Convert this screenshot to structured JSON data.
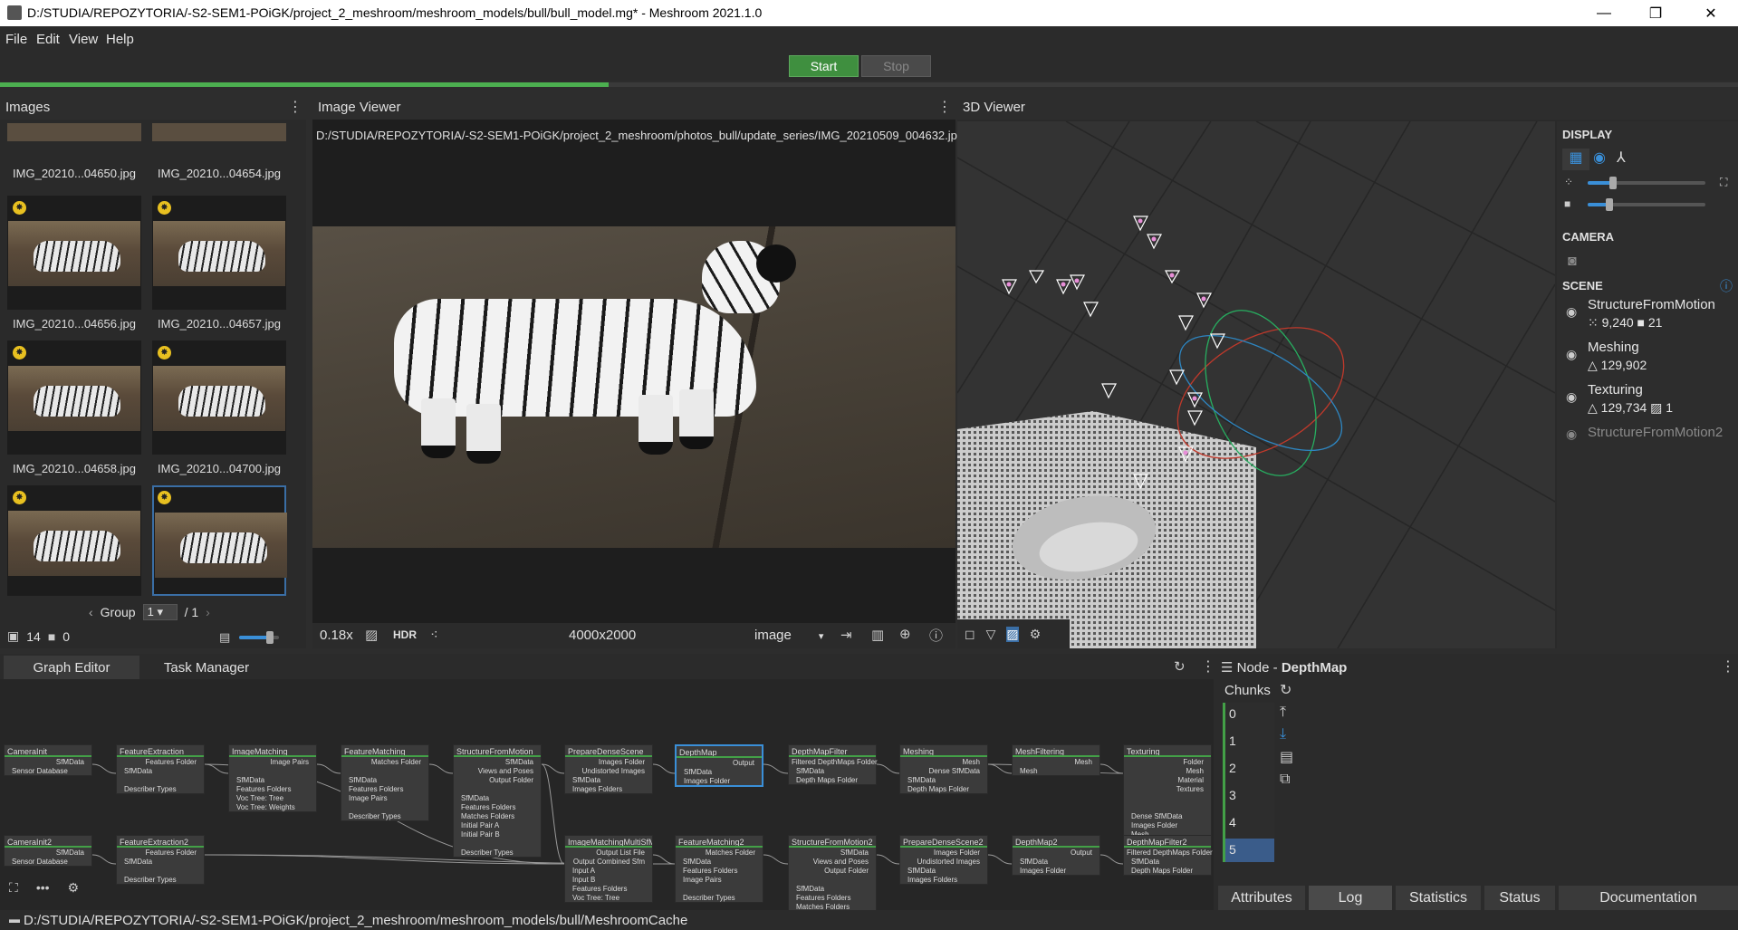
{
  "window": {
    "title": "D:/STUDIA/REPOZYTORIA/-S2-SEM1-POiGK/project_2_meshroom/meshroom_models/bull/bull_model.mg* - Meshroom 2021.1.0",
    "minimize": "—",
    "maximize": "❐",
    "close": "✕"
  },
  "menu": [
    "File",
    "Edit",
    "View",
    "Help"
  ],
  "toolbar": {
    "start": "Start",
    "stop": "Stop",
    "progress_fraction": 0.35
  },
  "images_panel": {
    "title": "Images",
    "top_labels": [
      "IMG_20210...04650.jpg",
      "IMG_20210...04654.jpg"
    ],
    "thumbs": [
      {
        "label": "IMG_20210...04656.jpg"
      },
      {
        "label": "IMG_20210...04657.jpg"
      },
      {
        "label": "IMG_20210...04658.jpg"
      },
      {
        "label": "IMG_20210...04700.jpg"
      },
      {
        "label": ""
      },
      {
        "label": ""
      }
    ],
    "group_label": "Group",
    "group_value": "1",
    "group_total": "/ 1",
    "image_count": "14",
    "camera_count": "0"
  },
  "image_viewer": {
    "title": "Image Viewer",
    "path": "D:/STUDIA/REPOZYTORIA/-S2-SEM1-POiGK/project_2_meshroom/photos_bull/update_series/IMG_20210509_004632.jpg",
    "zoom": "0.18x",
    "hdr": "HDR",
    "resolution": "4000x2000",
    "mode": "image"
  },
  "viewer3d": {
    "title": "3D Viewer",
    "display_label": "DISPLAY",
    "camera_label": "CAMERA",
    "scene_label": "SCENE",
    "scene_items": [
      {
        "name": "StructureFromMotion",
        "stats": "⁙ 9,240  ■ 21",
        "dim": false
      },
      {
        "name": "Meshing",
        "stats": "△ 129,902",
        "dim": false
      },
      {
        "name": "Texturing",
        "stats": "△ 129,734  ▨ 1",
        "dim": false
      },
      {
        "name": "StructureFromMotion2",
        "stats": "",
        "dim": true
      }
    ]
  },
  "bottom": {
    "tabs": [
      "Graph Editor",
      "Task Manager"
    ],
    "node_label": "Node - ",
    "node_name": "DepthMap",
    "chunks_label": "Chunks",
    "chunks": [
      "0",
      "1",
      "2",
      "3",
      "4",
      "5"
    ],
    "bottom_tabs": [
      "Attributes",
      "Log",
      "Statistics",
      "Status",
      "Documentation"
    ]
  },
  "graph_nodes": [
    {
      "title": "CameraInit",
      "ports": [
        {
          "t": "SfMData",
          "o": true
        },
        {
          "t": "Sensor Database",
          "o": false
        }
      ]
    },
    {
      "title": "FeatureExtraction",
      "ports": [
        {
          "t": "Features Folder",
          "o": true
        },
        {
          "t": "SfMData",
          "o": false
        },
        {
          "t": "",
          "o": false
        },
        {
          "t": "Describer Types",
          "o": false
        }
      ]
    },
    {
      "title": "ImageMatching",
      "ports": [
        {
          "t": "Image Pairs",
          "o": true
        },
        {
          "t": "",
          "o": false
        },
        {
          "t": "SfMData",
          "o": false
        },
        {
          "t": "Features Folders",
          "o": false
        },
        {
          "t": "Voc Tree: Tree",
          "o": false
        },
        {
          "t": "Voc Tree: Weights",
          "o": false
        }
      ]
    },
    {
      "title": "FeatureMatching",
      "ports": [
        {
          "t": "Matches Folder",
          "o": true
        },
        {
          "t": "",
          "o": false
        },
        {
          "t": "SfMData",
          "o": false
        },
        {
          "t": "Features Folders",
          "o": false
        },
        {
          "t": "Image Pairs",
          "o": false
        },
        {
          "t": "",
          "o": false
        },
        {
          "t": "Describer Types",
          "o": false
        }
      ]
    },
    {
      "title": "StructureFromMotion",
      "ports": [
        {
          "t": "SfMData",
          "o": true
        },
        {
          "t": "Views and Poses",
          "o": true
        },
        {
          "t": "Output Folder",
          "o": true
        },
        {
          "t": "",
          "o": false
        },
        {
          "t": "SfMData",
          "o": false
        },
        {
          "t": "Features Folders",
          "o": false
        },
        {
          "t": "Matches Folders",
          "o": false
        },
        {
          "t": "Initial Pair A",
          "o": false
        },
        {
          "t": "Initial Pair B",
          "o": false
        },
        {
          "t": "",
          "o": false
        },
        {
          "t": "Describer Types",
          "o": false
        }
      ]
    },
    {
      "title": "PrepareDenseScene",
      "ports": [
        {
          "t": "Images Folder",
          "o": true
        },
        {
          "t": "Undistorted Images",
          "o": true
        },
        {
          "t": "SfMData",
          "o": false
        },
        {
          "t": "Images Folders",
          "o": false
        }
      ]
    },
    {
      "title": "DepthMap",
      "ports": [
        {
          "t": "Output",
          "o": true
        },
        {
          "t": "SfMData",
          "o": false
        },
        {
          "t": "Images Folder",
          "o": false
        }
      ]
    },
    {
      "title": "DepthMapFilter",
      "ports": [
        {
          "t": "Filtered DepthMaps Folder",
          "o": true
        },
        {
          "t": "SfMData",
          "o": false
        },
        {
          "t": "Depth Maps Folder",
          "o": false
        }
      ]
    },
    {
      "title": "Meshing",
      "ports": [
        {
          "t": "Mesh",
          "o": true
        },
        {
          "t": "Dense SfMData",
          "o": true
        },
        {
          "t": "SfMData",
          "o": false
        },
        {
          "t": "Depth Maps Folder",
          "o": false
        }
      ]
    },
    {
      "title": "MeshFiltering",
      "ports": [
        {
          "t": "Mesh",
          "o": true
        },
        {
          "t": "Mesh",
          "o": false
        }
      ]
    },
    {
      "title": "Texturing",
      "ports": [
        {
          "t": "Folder",
          "o": true
        },
        {
          "t": "Mesh",
          "o": true
        },
        {
          "t": "Material",
          "o": true
        },
        {
          "t": "Textures",
          "o": true
        },
        {
          "t": "",
          "o": false
        },
        {
          "t": "",
          "o": false
        },
        {
          "t": "Dense SfMData",
          "o": false
        },
        {
          "t": "Images Folder",
          "o": false
        },
        {
          "t": "Mesh",
          "o": false
        }
      ]
    },
    {
      "title": "CameraInit2",
      "ports": [
        {
          "t": "SfMData",
          "o": true
        },
        {
          "t": "Sensor Database",
          "o": false
        }
      ]
    },
    {
      "title": "FeatureExtraction2",
      "ports": [
        {
          "t": "Features Folder",
          "o": true
        },
        {
          "t": "SfMData",
          "o": false
        },
        {
          "t": "",
          "o": false
        },
        {
          "t": "Describer Types",
          "o": false
        }
      ]
    },
    {
      "title": "ImageMatchingMultiSfM",
      "ports": [
        {
          "t": "Output List File",
          "o": true
        },
        {
          "t": "Output Combined Sfm",
          "o": true
        },
        {
          "t": "Input A",
          "o": false
        },
        {
          "t": "Input B",
          "o": false
        },
        {
          "t": "Features Folders",
          "o": false
        },
        {
          "t": "Voc Tree: Tree",
          "o": false
        }
      ]
    },
    {
      "title": "FeatureMatching2",
      "ports": [
        {
          "t": "Matches Folder",
          "o": true
        },
        {
          "t": "SfMData",
          "o": false
        },
        {
          "t": "Features Folders",
          "o": false
        },
        {
          "t": "Image Pairs",
          "o": false
        },
        {
          "t": "",
          "o": false
        },
        {
          "t": "Describer Types",
          "o": false
        }
      ]
    },
    {
      "title": "StructureFromMotion2",
      "ports": [
        {
          "t": "SfMData",
          "o": true
        },
        {
          "t": "Views and Poses",
          "o": true
        },
        {
          "t": "Output Folder",
          "o": true
        },
        {
          "t": "",
          "o": false
        },
        {
          "t": "SfMData",
          "o": false
        },
        {
          "t": "Features Folders",
          "o": false
        },
        {
          "t": "Matches Folders",
          "o": false
        }
      ]
    },
    {
      "title": "PrepareDenseScene2",
      "ports": [
        {
          "t": "Images Folder",
          "o": true
        },
        {
          "t": "Undistorted Images",
          "o": true
        },
        {
          "t": "SfMData",
          "o": false
        },
        {
          "t": "Images Folders",
          "o": false
        }
      ]
    },
    {
      "title": "DepthMap2",
      "ports": [
        {
          "t": "Output",
          "o": true
        },
        {
          "t": "SfMData",
          "o": false
        },
        {
          "t": "Images Folder",
          "o": false
        }
      ]
    },
    {
      "title": "DepthMapFilter2",
      "ports": [
        {
          "t": "Filtered DepthMaps Folder",
          "o": true
        },
        {
          "t": "SfMData",
          "o": false
        },
        {
          "t": "Depth Maps Folder",
          "o": false
        }
      ]
    }
  ],
  "statusbar": {
    "path": "D:/STUDIA/REPOZYTORIA/-S2-SEM1-POiGK/project_2_meshroom/meshroom_models/bull/MeshroomCache"
  },
  "colors": {
    "accent": "#3a8fd8",
    "start": "#3f8f3f",
    "progress": "#4caf50"
  }
}
